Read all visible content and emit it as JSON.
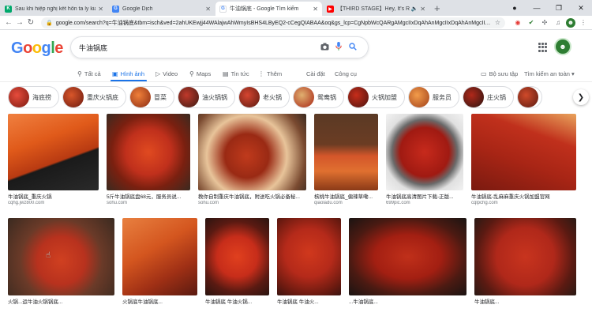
{
  "tabs": [
    {
      "title": "Sau khi hiệp nghị kết hôn ta ly kia",
      "favicon_color": "#00a86b",
      "favicon_glyph": "K"
    },
    {
      "title": "Google Dịch",
      "favicon_color": "#4285f4",
      "favicon_glyph": "G"
    },
    {
      "title": "牛油锅底 - Google Tìm kiếm",
      "favicon_color": "#ffffff",
      "favicon_glyph": "G"
    },
    {
      "title": "【THIRD STAGE】Hey, It's Rain",
      "favicon_color": "#ff0000",
      "favicon_glyph": "▶"
    }
  ],
  "window_controls": {
    "minimize": "—",
    "maximize": "❐",
    "close": "✕"
  },
  "address": {
    "url": "google.com/search?q=牛油锅底&tbm=isch&ved=2ahUKEwjj44WAlajwAhWmyIsBHS4LByEQ2-cCegQIABAA&oq&gs_lcp=CgNpbWcQARgAMgcIIxDqAhAnMgcIIxDqAhAnMgcIIxD..."
  },
  "search": {
    "query": "牛油锅底"
  },
  "nav": {
    "all": "Tất cả",
    "images": "Hình ảnh",
    "video": "Video",
    "maps": "Maps",
    "news": "Tin tức",
    "more": "Thêm",
    "settings": "Cài đặt",
    "tools": "Công cụ",
    "collection": "Bộ sưu tập",
    "safesearch": "Tìm kiếm an toàn ▾"
  },
  "chips": [
    {
      "label": "海底捞",
      "color": "#c0392b"
    },
    {
      "label": "重庆火锅底",
      "color": "#b03a2e"
    },
    {
      "label": "冒菜",
      "color": "#d35400"
    },
    {
      "label": "油火锅锅",
      "color": "#8e2c20"
    },
    {
      "label": "老火锅",
      "color": "#a93226"
    },
    {
      "label": "鸳鸯锅",
      "color": "#922b21"
    },
    {
      "label": "火锅加盟",
      "color": "#c0392b"
    },
    {
      "label": "服务员",
      "color": "#e67e22"
    },
    {
      "label": "庄火锅",
      "color": "#7b241c"
    },
    {
      "label": "",
      "color": "#b03a2e"
    }
  ],
  "results_row1": [
    {
      "caption": "牛油锅底_重庆火锅",
      "site": "cqhg.jwz800.com",
      "color_a": "#e8621f",
      "color_b": "#1c1c1c"
    },
    {
      "caption": "5斤牛油锅底盘68元，服务员说...",
      "site": "sohu.com",
      "color_a": "#c0301c",
      "color_b": "#5a1a10"
    },
    {
      "caption": "教你自制重庆牛油锅底，附送吃火锅必备秘...",
      "site": "sohu.com",
      "color_a": "#b5381f",
      "color_b": "#e8c49a"
    },
    {
      "caption": "核桃牛油锅底_偏辣草嘞...",
      "site": "qiaoladu.com",
      "color_a": "#6b3c23",
      "color_b": "#d4562a"
    },
    {
      "caption": "牛油锅底高清图片下载-正版...",
      "site": "699pic.com",
      "color_a": "#c72a1c",
      "color_b": "#e0e0e0"
    },
    {
      "caption": "牛油锅底-乱麻麻重庆火锅加盟官网",
      "site": "cqlpchg.com",
      "color_a": "#a82515",
      "color_b": "#e9a35c"
    }
  ],
  "results_row2": [
    {
      "caption": "火锅...运牛油火锅锅底...",
      "site": "",
      "color_a": "#b8321e",
      "color_b": "#3a2a20"
    },
    {
      "caption": "火锅底牛油锅底...",
      "site": "",
      "color_a": "#d4561f",
      "color_b": "#7a2a15"
    },
    {
      "caption": "牛油锅底 牛油火锅...",
      "site": "",
      "color_a": "#c72d1a",
      "color_b": "#3a1a12"
    },
    {
      "caption": "牛油锅底 牛油火...",
      "site": "",
      "color_a": "#b52a1a",
      "color_b": "#6a1a10"
    },
    {
      "caption": "...牛油锅底...",
      "site": "",
      "color_a": "#a31f12",
      "color_b": "#1a1412"
    },
    {
      "caption": "牛油锅底...",
      "site": "",
      "color_a": "#b0281a",
      "color_b": "#2a1a14"
    }
  ]
}
